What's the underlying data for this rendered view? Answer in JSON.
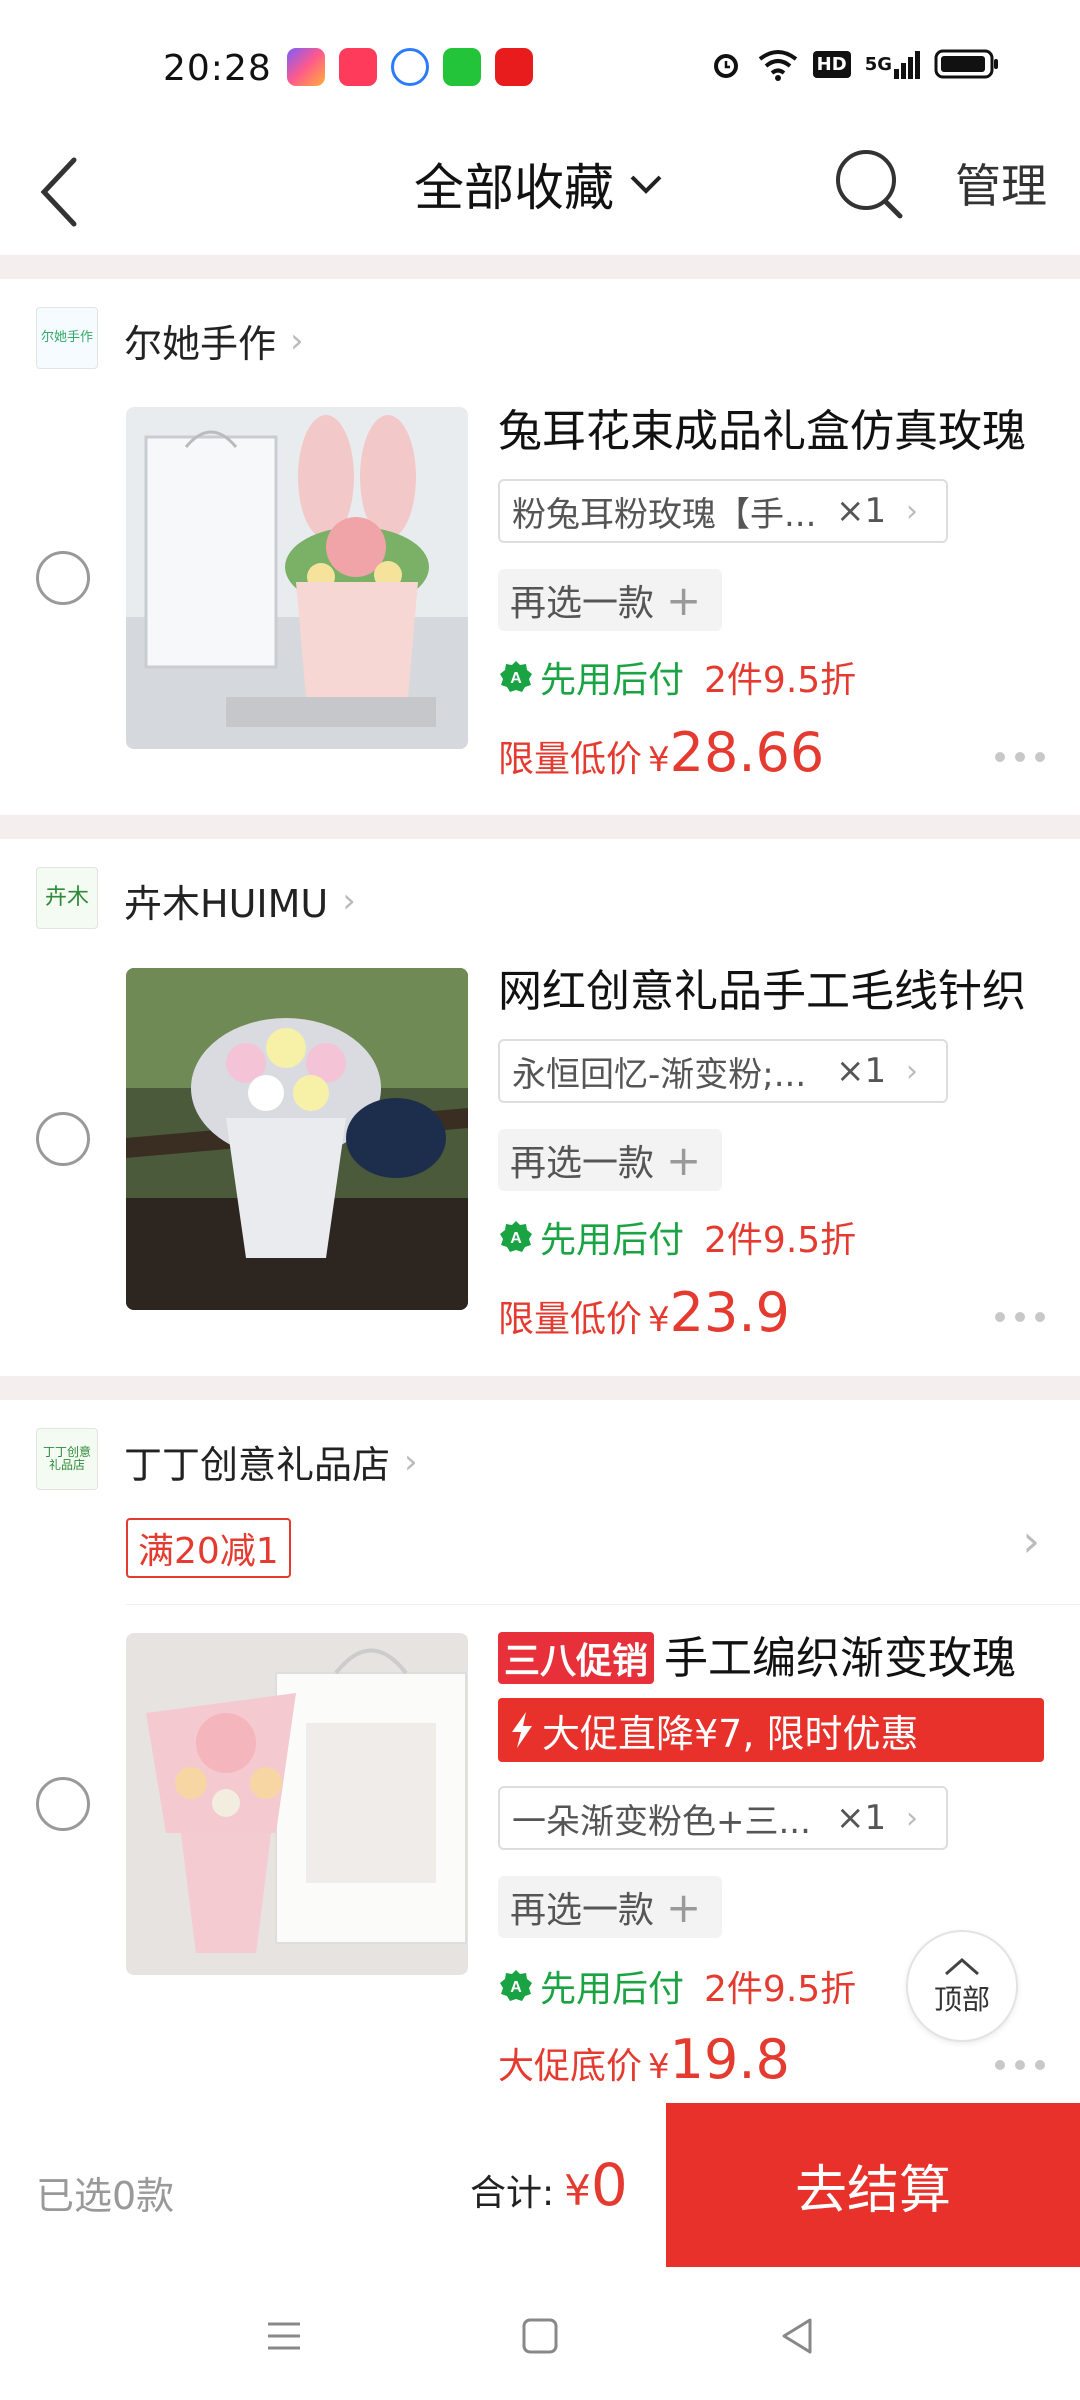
{
  "status_bar": {
    "time": "20:28",
    "network": "5G",
    "hd": "HD",
    "icons": [
      "app-icon",
      "app-icon",
      "app-icon",
      "iqiyi-icon",
      "app-icon",
      "alarm-icon",
      "wifi-icon",
      "hd-icon",
      "signal-icon",
      "battery-icon"
    ]
  },
  "header": {
    "title": "全部收藏",
    "manage": "管理"
  },
  "items": [
    {
      "shop_name": "尔她手作",
      "shop_logo_text": "尔她手作",
      "title": "兔耳花束成品礼盒仿真玫瑰",
      "sku": "粉兔耳粉玫瑰【手...",
      "qty": "×1",
      "reselect": "再选一款",
      "bnpl": "先用后付",
      "discount": "2件9.5折",
      "price_label": "限量低价",
      "currency": "¥",
      "price": "28.66"
    },
    {
      "shop_name": "卉木HUIMU",
      "shop_logo_text": "卉木",
      "title": "网红创意礼品手工毛线针织",
      "sku": "永恒回忆-渐变粉;...",
      "qty": "×1",
      "reselect": "再选一款",
      "bnpl": "先用后付",
      "discount": "2件9.5折",
      "price_label": "限量低价",
      "currency": "¥",
      "price": "23.9"
    },
    {
      "shop_name": "丁丁创意礼品店",
      "shop_logo_text": "丁丁创意礼品店",
      "coupon": "满20减1",
      "promo_badge": "三八促销",
      "title": "手工编织渐变玫瑰",
      "flash": "大促直降¥7, 限时优惠",
      "sku": "一朵渐变粉色+三...",
      "qty": "×1",
      "reselect": "再选一款",
      "bnpl": "先用后付",
      "discount": "2件9.5折",
      "price_label": "大促底价",
      "currency": "¥",
      "price": "19.8"
    }
  ],
  "top_button": "顶部",
  "bottom_bar": {
    "selected": "已选0款",
    "total_label": "合计:",
    "currency": "¥",
    "total": "0",
    "checkout": "去结算"
  },
  "colors": {
    "accent_red": "#e8312b",
    "price_red": "#e53a2f",
    "bnpl_green": "#1aa342",
    "separator": "#f5eeee"
  }
}
